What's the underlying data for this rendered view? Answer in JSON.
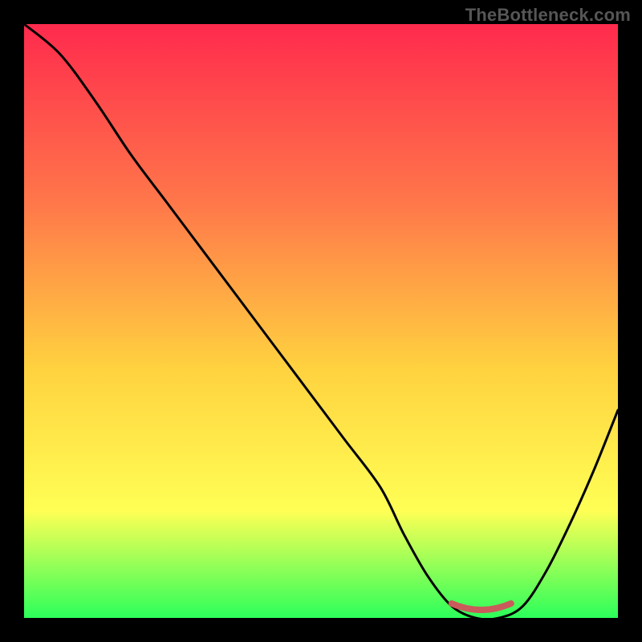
{
  "watermark": "TheBottleneck.com",
  "colors": {
    "gradient_top": "#ff2a4d",
    "gradient_mid1": "#ff774a",
    "gradient_mid2": "#ffd23f",
    "gradient_mid3": "#ffff55",
    "gradient_bottom": "#2cff5a",
    "curve_stroke": "#000000",
    "marker_stroke": "#c95b5b",
    "frame": "#000000"
  },
  "chart_data": {
    "type": "line",
    "title": "",
    "xlabel": "",
    "ylabel": "",
    "xlim": [
      0,
      100
    ],
    "ylim": [
      0,
      100
    ],
    "x": [
      0,
      6,
      12,
      18,
      24,
      30,
      36,
      42,
      48,
      54,
      60,
      64,
      68,
      72,
      76,
      80,
      84,
      88,
      92,
      96,
      100
    ],
    "values": [
      100,
      95,
      87,
      78,
      70,
      62,
      54,
      46,
      38,
      30,
      22,
      14,
      7,
      2,
      0,
      0,
      2,
      8,
      16,
      25,
      35
    ],
    "minimum_plateau": {
      "x_start": 72,
      "x_end": 82,
      "y": 0
    },
    "note": "Values are read off the image as approximate percentage heights; x is position across the plot area. The curve descends steeply from top-left, flattens near zero around x≈72–82 (red marker), then rises toward the right."
  }
}
